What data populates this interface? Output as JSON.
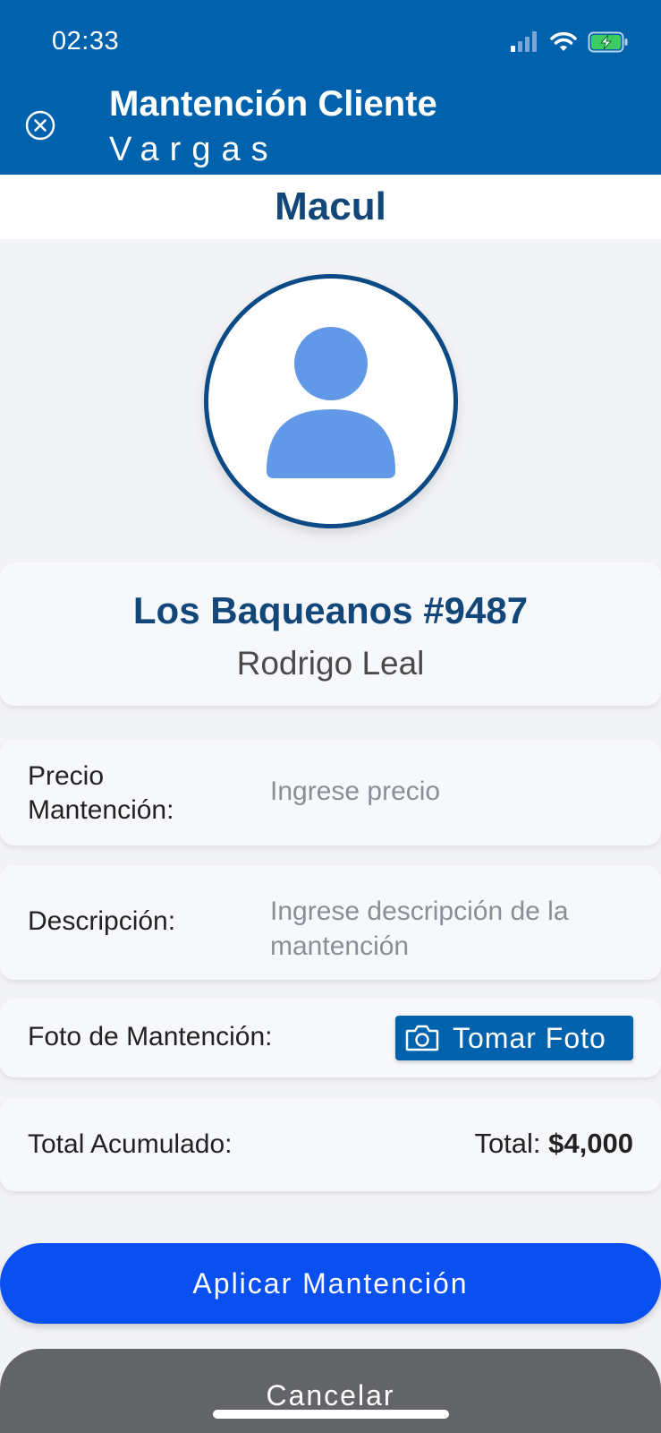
{
  "status_bar": {
    "time": "02:33"
  },
  "header": {
    "title": "Mantención Cliente",
    "subtitle": "Vargas"
  },
  "location": {
    "name": "Macul"
  },
  "client": {
    "address": "Los Baqueanos #9487",
    "person": "Rodrigo Leal"
  },
  "form": {
    "precio_label": "Precio Mantención:",
    "precio_placeholder": "Ingrese precio",
    "descripcion_label": "Descripción:",
    "descripcion_placeholder": "Ingrese descripción de la mantención",
    "foto_label": "Foto de Mantención:",
    "foto_button": "Tomar Foto",
    "total_label": "Total Acumulado:",
    "total_prefix": "Total:",
    "total_amount": "$4,000"
  },
  "actions": {
    "apply": "Aplicar Mantención",
    "cancel": "Cancelar"
  },
  "colors": {
    "header": "#0062ad",
    "title": "#134779",
    "apply_button": "#0a4ff0",
    "cancel_button": "#636468",
    "avatar_fill": "#6199e8"
  },
  "icons": [
    "close-icon",
    "signal-icon",
    "wifi-icon",
    "battery-charging-icon",
    "user-avatar-icon",
    "camera-icon"
  ]
}
